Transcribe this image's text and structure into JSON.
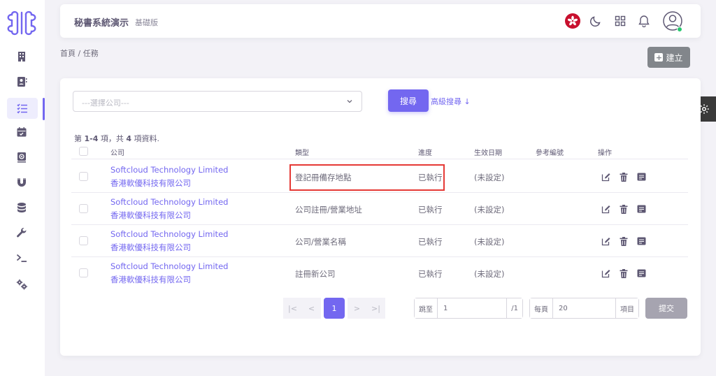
{
  "app": {
    "title": "秘書系統演示",
    "edition": "基礎版"
  },
  "sidebar": {
    "items": [
      {
        "icon": "building-icon"
      },
      {
        "icon": "contact-book-icon"
      },
      {
        "icon": "task-list-icon",
        "active": true
      },
      {
        "icon": "calendar-icon"
      },
      {
        "icon": "email-icon"
      },
      {
        "icon": "magnet-icon"
      },
      {
        "icon": "database-icon"
      },
      {
        "icon": "wrench-icon"
      },
      {
        "icon": "terminal-icon"
      },
      {
        "icon": "gears-icon"
      }
    ]
  },
  "header": {
    "icons": [
      "hong-kong-flag-icon",
      "moon-icon",
      "grid-icon",
      "bell-icon",
      "user-avatar-icon"
    ]
  },
  "breadcrumb": "首頁 / 任務",
  "toolbar": {
    "create_label": "建立"
  },
  "filters": {
    "company_placeholder": "---選擇公司---",
    "search_label": "搜尋",
    "advanced_label": "高級搜尋 ↓"
  },
  "summary": {
    "prefix": "第 ",
    "range": "1-4",
    "mid": " 項，共 ",
    "total": "4",
    "suffix": " 項資料."
  },
  "table": {
    "headers": [
      "公司",
      "類型",
      "進度",
      "生效日期",
      "參考編號",
      "操作"
    ],
    "rows": [
      {
        "company_en": "Softcloud Technology Limited",
        "company_zh": "香港軟優科技有限公司",
        "type": "登記冊備存地點",
        "progress": "已執行",
        "effective_date": "(未設定)",
        "reference": ""
      },
      {
        "company_en": "Softcloud Technology Limited",
        "company_zh": "香港軟優科技有限公司",
        "type": "公司註冊/營業地址",
        "progress": "已執行",
        "effective_date": "(未設定)",
        "reference": ""
      },
      {
        "company_en": "Softcloud Technology Limited",
        "company_zh": "香港軟優科技有限公司",
        "type": "公司/營業名稱",
        "progress": "已執行",
        "effective_date": "(未設定)",
        "reference": ""
      },
      {
        "company_en": "Softcloud Technology Limited",
        "company_zh": "香港軟優科技有限公司",
        "type": "註冊新公司",
        "progress": "已執行",
        "effective_date": "(未設定)",
        "reference": ""
      }
    ]
  },
  "pagination": {
    "first": "|<",
    "prev": "<",
    "current": "1",
    "next": ">",
    "last": ">|",
    "goto_label": "跳至",
    "goto_value": "1",
    "total_pages": "/1",
    "per_page_label": "每頁",
    "per_page_value": "20",
    "items_label": "項目",
    "submit_label": "提交"
  }
}
